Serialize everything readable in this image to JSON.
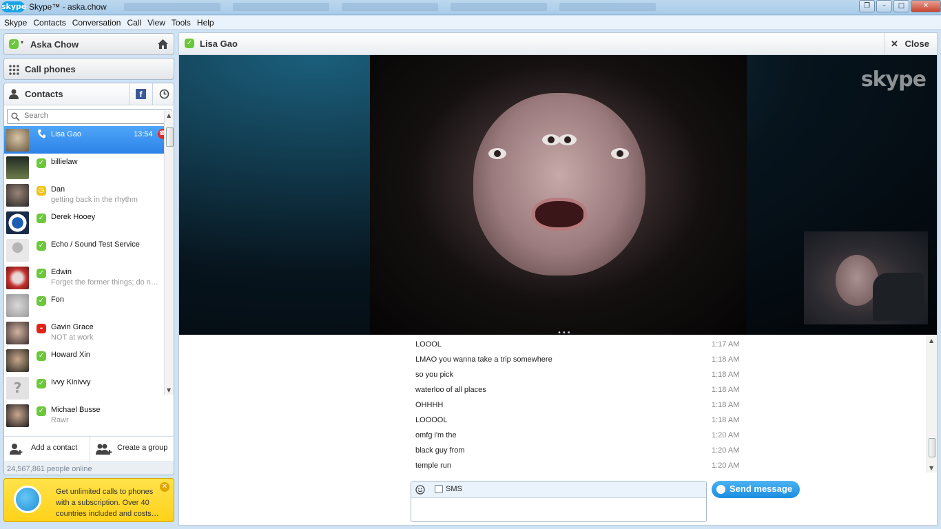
{
  "window": {
    "logo": "skype",
    "title": "Skype™ - aska.chow"
  },
  "menu": [
    "Skype",
    "Contacts",
    "Conversation",
    "Call",
    "View",
    "Tools",
    "Help"
  ],
  "profile": {
    "name": "Aska Chow",
    "status": "online"
  },
  "call_phones": {
    "label": "Call phones"
  },
  "contacts_tab": {
    "label": "Contacts"
  },
  "search": {
    "placeholder": "Search"
  },
  "active_contact": {
    "name": "Lisa Gao",
    "time": "13:54"
  },
  "contacts": [
    {
      "name": "billielaw",
      "mood": "",
      "status": "online"
    },
    {
      "name": "Dan",
      "mood": "getting back in the rhythm",
      "status": "away"
    },
    {
      "name": "Derek Hooey",
      "mood": "",
      "status": "online"
    },
    {
      "name": "Echo / Sound Test Service",
      "mood": "",
      "status": "online"
    },
    {
      "name": "Edwin",
      "mood": "Forget the former things; do n…",
      "status": "online"
    },
    {
      "name": "Fon",
      "mood": "",
      "status": "online"
    },
    {
      "name": "Gavin Grace",
      "mood": "NOT at work",
      "status": "busy"
    },
    {
      "name": "Howard Xin",
      "mood": "",
      "status": "online"
    },
    {
      "name": "Ivvy Kinivvy",
      "mood": "",
      "status": "online"
    },
    {
      "name": "Michael Busse",
      "mood": "Rawr",
      "status": "online"
    }
  ],
  "bottom_actions": {
    "add_contact": "Add a contact",
    "create_group": "Create a group"
  },
  "online_count": "24,567,861 people online",
  "promo": {
    "text": "Get unlimited calls to phones with a subscription. Over 40 countries included and costs…"
  },
  "conversation": {
    "title": "Lisa Gao",
    "close_label": "Close",
    "watermark": "skype",
    "messages": [
      {
        "text": "LOOOL",
        "time": "1:17 AM"
      },
      {
        "text": "LMAO you wanna take a trip somewhere",
        "time": "1:18 AM"
      },
      {
        "text": "so you pick",
        "time": "1:18 AM"
      },
      {
        "text": "waterloo of all places",
        "time": "1:18 AM"
      },
      {
        "text": "OHHHH",
        "time": "1:18 AM"
      },
      {
        "text": "LOOOOL",
        "time": "1:18 AM"
      },
      {
        "text": "omfg i'm the",
        "time": "1:20 AM"
      },
      {
        "text": "black guy from",
        "time": "1:20 AM"
      },
      {
        "text": "temple run",
        "time": "1:20 AM"
      }
    ]
  },
  "compose": {
    "sms_label": "SMS",
    "send_label": "Send message"
  },
  "colors": {
    "accent": "#2d82e8",
    "online": "#6bc83b",
    "away": "#f0c21a",
    "busy": "#e2231a",
    "promo": "#ffd21a"
  }
}
